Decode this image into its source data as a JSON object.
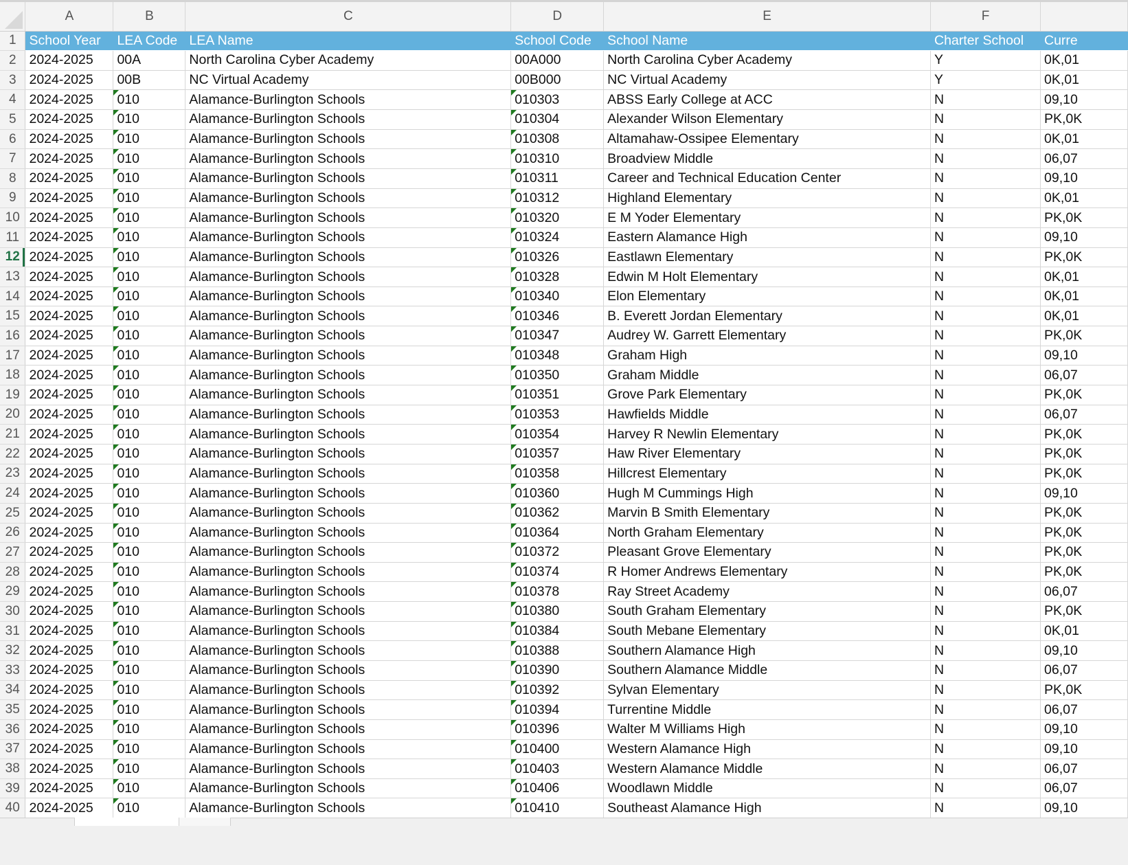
{
  "columns": [
    "A",
    "B",
    "C",
    "D",
    "E",
    "F",
    ""
  ],
  "header": [
    "School Year",
    "LEA Code",
    "LEA Name",
    "School Code",
    "School Name",
    "Charter School",
    "Curre"
  ],
  "active_row": 12,
  "rows": [
    [
      "2024-2025",
      "00A",
      "North Carolina Cyber Academy",
      "00A000",
      "North Carolina Cyber Academy",
      "Y",
      "0K,01"
    ],
    [
      "2024-2025",
      "00B",
      "NC Virtual Academy",
      "00B000",
      "NC Virtual Academy",
      "Y",
      "0K,01"
    ],
    [
      "2024-2025",
      "010",
      "Alamance-Burlington Schools",
      "010303",
      "ABSS Early College at ACC",
      "N",
      "09,10"
    ],
    [
      "2024-2025",
      "010",
      "Alamance-Burlington Schools",
      "010304",
      "Alexander Wilson Elementary",
      "N",
      "PK,0K"
    ],
    [
      "2024-2025",
      "010",
      "Alamance-Burlington Schools",
      "010308",
      "Altamahaw-Ossipee Elementary",
      "N",
      "0K,01"
    ],
    [
      "2024-2025",
      "010",
      "Alamance-Burlington Schools",
      "010310",
      "Broadview Middle",
      "N",
      "06,07"
    ],
    [
      "2024-2025",
      "010",
      "Alamance-Burlington Schools",
      "010311",
      "Career and Technical Education Center",
      "N",
      "09,10"
    ],
    [
      "2024-2025",
      "010",
      "Alamance-Burlington Schools",
      "010312",
      "Highland Elementary",
      "N",
      "0K,01"
    ],
    [
      "2024-2025",
      "010",
      "Alamance-Burlington Schools",
      "010320",
      "E M Yoder Elementary",
      "N",
      "PK,0K"
    ],
    [
      "2024-2025",
      "010",
      "Alamance-Burlington Schools",
      "010324",
      "Eastern Alamance High",
      "N",
      "09,10"
    ],
    [
      "2024-2025",
      "010",
      "Alamance-Burlington Schools",
      "010326",
      "Eastlawn Elementary",
      "N",
      "PK,0K"
    ],
    [
      "2024-2025",
      "010",
      "Alamance-Burlington Schools",
      "010328",
      "Edwin M Holt Elementary",
      "N",
      "0K,01"
    ],
    [
      "2024-2025",
      "010",
      "Alamance-Burlington Schools",
      "010340",
      "Elon Elementary",
      "N",
      "0K,01"
    ],
    [
      "2024-2025",
      "010",
      "Alamance-Burlington Schools",
      "010346",
      "B. Everett Jordan Elementary",
      "N",
      "0K,01"
    ],
    [
      "2024-2025",
      "010",
      "Alamance-Burlington Schools",
      "010347",
      "Audrey W. Garrett Elementary",
      "N",
      "PK,0K"
    ],
    [
      "2024-2025",
      "010",
      "Alamance-Burlington Schools",
      "010348",
      "Graham High",
      "N",
      "09,10"
    ],
    [
      "2024-2025",
      "010",
      "Alamance-Burlington Schools",
      "010350",
      "Graham Middle",
      "N",
      "06,07"
    ],
    [
      "2024-2025",
      "010",
      "Alamance-Burlington Schools",
      "010351",
      "Grove Park Elementary",
      "N",
      "PK,0K"
    ],
    [
      "2024-2025",
      "010",
      "Alamance-Burlington Schools",
      "010353",
      "Hawfields Middle",
      "N",
      "06,07"
    ],
    [
      "2024-2025",
      "010",
      "Alamance-Burlington Schools",
      "010354",
      "Harvey R Newlin Elementary",
      "N",
      "PK,0K"
    ],
    [
      "2024-2025",
      "010",
      "Alamance-Burlington Schools",
      "010357",
      "Haw River Elementary",
      "N",
      "PK,0K"
    ],
    [
      "2024-2025",
      "010",
      "Alamance-Burlington Schools",
      "010358",
      "Hillcrest Elementary",
      "N",
      "PK,0K"
    ],
    [
      "2024-2025",
      "010",
      "Alamance-Burlington Schools",
      "010360",
      "Hugh M Cummings High",
      "N",
      "09,10"
    ],
    [
      "2024-2025",
      "010",
      "Alamance-Burlington Schools",
      "010362",
      "Marvin B Smith Elementary",
      "N",
      "PK,0K"
    ],
    [
      "2024-2025",
      "010",
      "Alamance-Burlington Schools",
      "010364",
      "North Graham Elementary",
      "N",
      "PK,0K"
    ],
    [
      "2024-2025",
      "010",
      "Alamance-Burlington Schools",
      "010372",
      "Pleasant Grove Elementary",
      "N",
      "PK,0K"
    ],
    [
      "2024-2025",
      "010",
      "Alamance-Burlington Schools",
      "010374",
      "R Homer Andrews Elementary",
      "N",
      "PK,0K"
    ],
    [
      "2024-2025",
      "010",
      "Alamance-Burlington Schools",
      "010378",
      "Ray Street Academy",
      "N",
      "06,07"
    ],
    [
      "2024-2025",
      "010",
      "Alamance-Burlington Schools",
      "010380",
      "South Graham Elementary",
      "N",
      "PK,0K"
    ],
    [
      "2024-2025",
      "010",
      "Alamance-Burlington Schools",
      "010384",
      "South Mebane Elementary",
      "N",
      "0K,01"
    ],
    [
      "2024-2025",
      "010",
      "Alamance-Burlington Schools",
      "010388",
      "Southern Alamance High",
      "N",
      "09,10"
    ],
    [
      "2024-2025",
      "010",
      "Alamance-Burlington Schools",
      "010390",
      "Southern Alamance Middle",
      "N",
      "06,07"
    ],
    [
      "2024-2025",
      "010",
      "Alamance-Burlington Schools",
      "010392",
      "Sylvan Elementary",
      "N",
      "PK,0K"
    ],
    [
      "2024-2025",
      "010",
      "Alamance-Burlington Schools",
      "010394",
      "Turrentine Middle",
      "N",
      "06,07"
    ],
    [
      "2024-2025",
      "010",
      "Alamance-Burlington Schools",
      "010396",
      "Walter M Williams High",
      "N",
      "09,10"
    ],
    [
      "2024-2025",
      "010",
      "Alamance-Burlington Schools",
      "010400",
      "Western Alamance High",
      "N",
      "09,10"
    ],
    [
      "2024-2025",
      "010",
      "Alamance-Burlington Schools",
      "010403",
      "Western Alamance Middle",
      "N",
      "06,07"
    ],
    [
      "2024-2025",
      "010",
      "Alamance-Burlington Schools",
      "010406",
      "Woodlawn Middle",
      "N",
      "06,07"
    ],
    [
      "2024-2025",
      "010",
      "Alamance-Burlington Schools",
      "010410",
      "Southeast Alamance High",
      "N",
      "09,10"
    ]
  ],
  "colors": {
    "header_fill": "#62b1dd",
    "header_text": "#ffffff",
    "error_indicator": "#1f7a1f",
    "active_row_number": "#217346"
  }
}
